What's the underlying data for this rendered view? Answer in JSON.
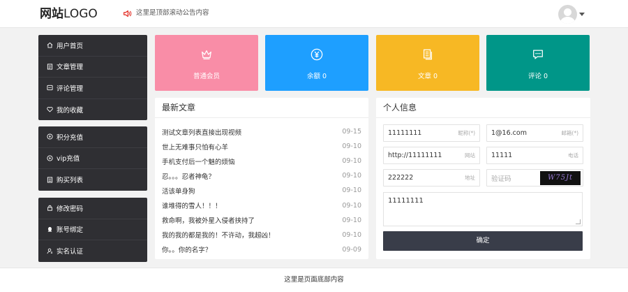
{
  "header": {
    "logo_bold": "网站",
    "logo_text": "LOGO",
    "notice": "这里是顶部滚动公告内容",
    "notice_color": "#e2231a"
  },
  "sidebar": {
    "group1": [
      {
        "label": "用户首页",
        "icon": "home-icon"
      },
      {
        "label": "文章管理",
        "icon": "document-icon"
      },
      {
        "label": "评论管理",
        "icon": "comment-box-icon"
      },
      {
        "label": "我的收藏",
        "icon": "heart-icon"
      }
    ],
    "group2": [
      {
        "label": "积分充值",
        "icon": "coin-icon"
      },
      {
        "label": "vip充值",
        "icon": "play-circle-icon"
      },
      {
        "label": "购买列表",
        "icon": "list-icon"
      }
    ],
    "group3": [
      {
        "label": "修改密码",
        "icon": "lock-icon"
      },
      {
        "label": "账号绑定",
        "icon": "qq-icon"
      },
      {
        "label": "实名认证",
        "icon": "user-id-icon"
      }
    ]
  },
  "cards": [
    {
      "label": "普通会员",
      "icon": "crown-icon",
      "color": "#f98da7"
    },
    {
      "label": "余额 0",
      "icon": "yen-icon",
      "color": "#1e9fff"
    },
    {
      "label": "文章 0",
      "icon": "articles-icon",
      "color": "#f7b824"
    },
    {
      "label": "评论 0",
      "icon": "chat-icon",
      "color": "#009688"
    }
  ],
  "articles": {
    "title": "最新文章",
    "items": [
      {
        "title": "测试文章列表直接出现视频",
        "date": "09-15"
      },
      {
        "title": "世上无难事只怕有心羊",
        "date": "09-10"
      },
      {
        "title": "手机支付后一个魅的烦恼",
        "date": "09-10"
      },
      {
        "title": "忍。。。忍者神龟？",
        "date": "09-10"
      },
      {
        "title": "活该单身狗",
        "date": "09-10"
      },
      {
        "title": "谁堆得的雪人！！！",
        "date": "09-10"
      },
      {
        "title": "救命啊，我被外星入侵者挟持了",
        "date": "09-10"
      },
      {
        "title": "我的我的都是我的！不许动，我超凶！",
        "date": "09-10"
      },
      {
        "title": "你。。你的名字？",
        "date": "09-09"
      }
    ]
  },
  "profile": {
    "title": "个人信息",
    "nickname": {
      "value": "11111111",
      "tag": "昵称(*)"
    },
    "email": {
      "value": "1@16.com",
      "tag": "邮箱(*)"
    },
    "website": {
      "value": "http://11111111",
      "tag": "网站"
    },
    "phone": {
      "value": "11111",
      "tag": "电话"
    },
    "address": {
      "value": "222222",
      "tag": "地址"
    },
    "captcha": {
      "placeholder": "验证码",
      "image_text": "W75Jt"
    },
    "bio": "11111111",
    "submit": "确定"
  },
  "footer": "这里是页面底部内容"
}
